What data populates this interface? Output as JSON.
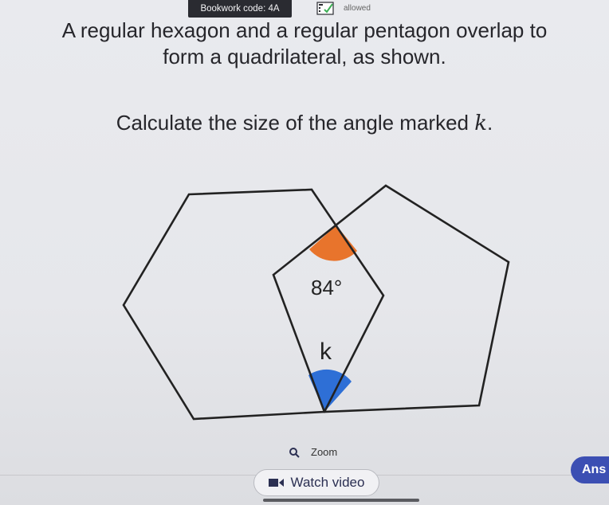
{
  "header": {
    "bookwork_label": "Bookwork code: 4A",
    "calculator_icon": "calculator-icon",
    "calculator_status": "allowed"
  },
  "question": {
    "line1": "A regular hexagon and a regular pentagon overlap to",
    "line2": "form a quadrilateral, as shown.",
    "line3_prefix": "Calculate the size of the angle marked ",
    "line3_var": "k",
    "line3_suffix": "."
  },
  "diagram": {
    "angle_label": "84°",
    "unknown_label": "k",
    "colors": {
      "top_angle": "#e8742c",
      "bottom_angle": "#2e6fd6",
      "stroke": "#222222"
    }
  },
  "footer": {
    "zoom_label": "Zoom",
    "watch_video_label": "Watch video",
    "answer_label": "Ans"
  }
}
